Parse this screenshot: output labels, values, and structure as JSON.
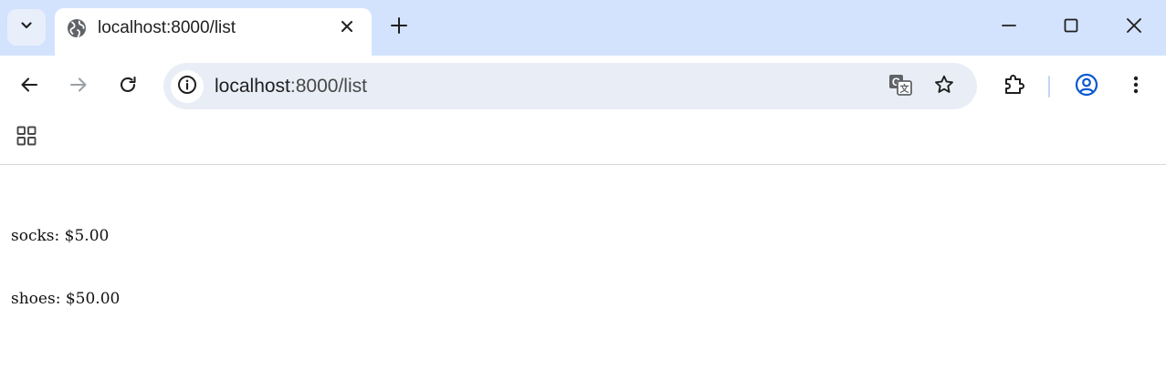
{
  "tab": {
    "title": "localhost:8000/list",
    "close_symbol": "✕",
    "favicon": "globe-icon"
  },
  "new_tab_symbol": "+",
  "omnibox": {
    "url_host": "localhost",
    "url_rest": ":8000/list"
  },
  "colors": {
    "tabstrip_bg": "#d3e3fd",
    "omnibox_bg": "#e9eef6",
    "profile_accent": "#0b57d0"
  },
  "page": {
    "items": [
      {
        "name": "socks",
        "price": "$5.00"
      },
      {
        "name": "shoes",
        "price": "$50.00"
      }
    ]
  }
}
